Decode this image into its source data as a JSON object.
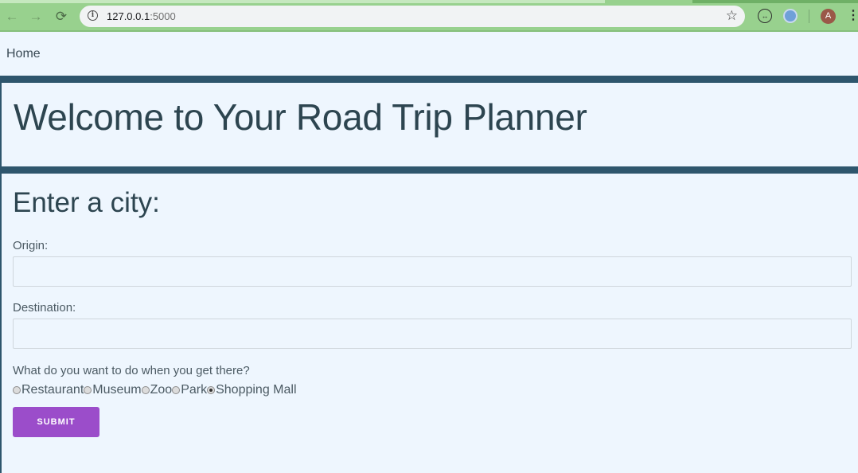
{
  "browser": {
    "url_host": "127.0.0.1",
    "url_port": ":5000",
    "profile_initial": "A",
    "icons": {
      "back": "arrow-left-icon",
      "forward": "arrow-right-icon",
      "reload": "reload-icon",
      "info": "info-icon",
      "bookmark": "star-icon",
      "menu": "vertical-dots-icon"
    }
  },
  "nav": {
    "home_label": "Home"
  },
  "banner": {
    "title": "Welcome to Your Road Trip Planner"
  },
  "form": {
    "heading": "Enter a city:",
    "origin_label": "Origin:",
    "origin_value": "",
    "destination_label": "Destination:",
    "destination_value": "",
    "activity_question": "What do you want to do when you get there?",
    "activities": [
      {
        "label": "Restaurant",
        "checked": false
      },
      {
        "label": "Museum",
        "checked": false
      },
      {
        "label": "Zoo",
        "checked": false
      },
      {
        "label": "Park",
        "checked": false
      },
      {
        "label": "Shopping Mall",
        "checked": true
      }
    ],
    "submit_label": "SUBMIT"
  },
  "colors": {
    "chrome_bar": "#98d18e",
    "page_background": "#eef6fe",
    "banner_border": "#2e566d",
    "submit_button": "#9b4dca"
  }
}
